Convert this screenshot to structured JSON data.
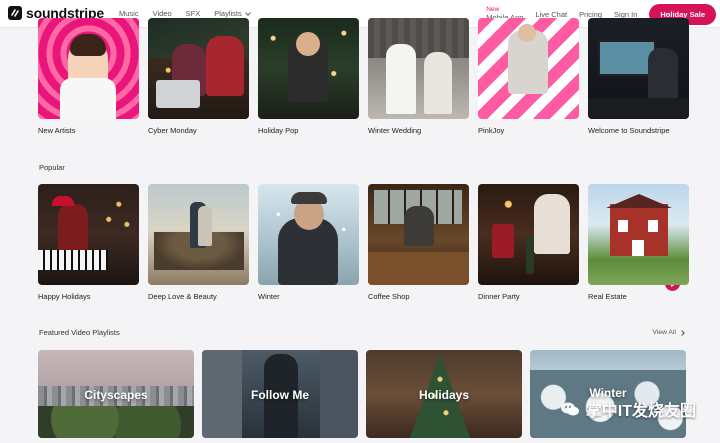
{
  "nav": {
    "logo": "soundstripe",
    "links": [
      "Music",
      "Video",
      "SFX",
      "Playlists"
    ],
    "mobile_new": "New",
    "mobile_app": "Mobile App",
    "live_chat": "Live Chat",
    "pricing": "Pricing",
    "sign_in": "Sign In",
    "sale": "Holiday Sale"
  },
  "top_row": {
    "items": [
      "New Artists",
      "Cyber Monday",
      "Holiday Pop",
      "Winter Wedding",
      "PinkJoy",
      "Welcome to Soundstripe"
    ]
  },
  "popular": {
    "title": "Popular",
    "items": [
      "Happy Holidays",
      "Deep Love & Beauty",
      "Winter",
      "Coffee Shop",
      "Dinner Party",
      "Real Estate"
    ]
  },
  "featured": {
    "title": "Featured Video Playlists",
    "view_all": "View All",
    "items": [
      "Cityscapes",
      "Follow Me",
      "Holidays",
      "Winter"
    ]
  },
  "watermark": "掌中IT发烧友圈",
  "colors": {
    "accent": "#d6125a",
    "background": "#f4f4f6"
  }
}
